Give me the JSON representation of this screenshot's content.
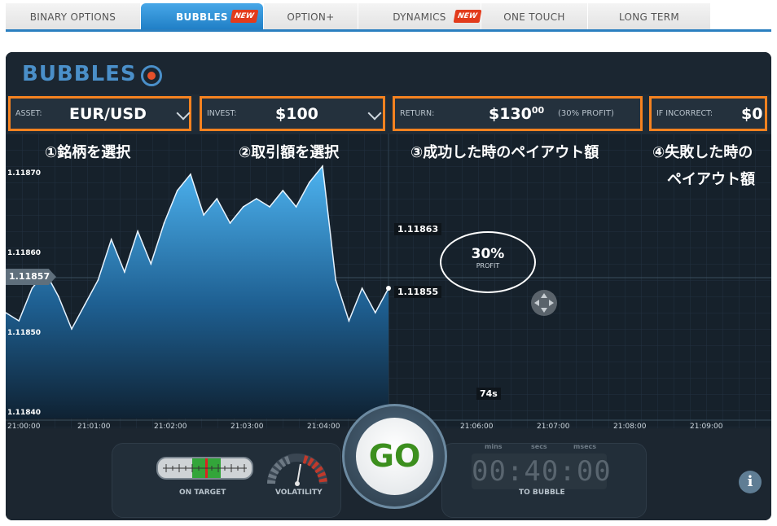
{
  "tabs": [
    {
      "label": "BINARY OPTIONS",
      "active": false,
      "badge": ""
    },
    {
      "label": "BUBBLES",
      "active": true,
      "badge": "NEW"
    },
    {
      "label": "OPTION+",
      "active": false,
      "badge": ""
    },
    {
      "label": "DYNAMICS",
      "active": false,
      "badge": "NEW"
    },
    {
      "label": "ONE TOUCH",
      "active": false,
      "badge": ""
    },
    {
      "label": "LONG TERM",
      "active": false,
      "badge": ""
    }
  ],
  "logo": {
    "text": "BUBBLES"
  },
  "controls": {
    "asset": {
      "label": "ASSET:",
      "value": "EUR/USD"
    },
    "invest": {
      "label": "INVEST:",
      "value": "$100"
    },
    "return": {
      "label": "RETURN:",
      "value": "$130",
      "cents": "00",
      "profit_note": "(30% PROFIT)"
    },
    "incorrect": {
      "label": "IF INCORRECT:",
      "value": "$0"
    }
  },
  "annotations": {
    "a1": "①銘柄を選択",
    "a2": "②取引額を選択",
    "a3": "③成功した時のペイアウト額",
    "a4_line1": "④失敗した時の",
    "a4_line2": "ペイアウト額"
  },
  "chart": {
    "y_labels": [
      "1.11870",
      "1.11860",
      "1.11850",
      "1.11840"
    ],
    "x_labels": [
      "21:00:00",
      "21:01:00",
      "21:02:00",
      "21:03:00",
      "21:04:00",
      "21:06:00",
      "21:07:00",
      "21:08:00",
      "21:09:00"
    ],
    "current_price": "1.11857",
    "upper_target": "1.11863",
    "lower_target": "1.11855",
    "profit_pct": "30%",
    "profit_label": "PROFIT",
    "timer": "74s"
  },
  "chart_data": {
    "type": "area",
    "title": "",
    "ylim": [
      1.1184,
      1.11872
    ],
    "xlabel": "",
    "ylabel": "",
    "x": [
      "21:00:00",
      "21:00:10",
      "21:00:20",
      "21:00:30",
      "21:00:40",
      "21:00:50",
      "21:01:00",
      "21:01:10",
      "21:01:20",
      "21:01:30",
      "21:01:40",
      "21:01:50",
      "21:02:00",
      "21:02:10",
      "21:02:20",
      "21:02:30",
      "21:02:40",
      "21:02:50",
      "21:03:00",
      "21:03:10",
      "21:03:20",
      "21:03:30",
      "21:03:40",
      "21:03:50",
      "21:04:00",
      "21:04:10",
      "21:04:20",
      "21:04:30",
      "21:04:40",
      "21:04:50"
    ],
    "series": [
      {
        "values": [
          1.11853,
          1.11852,
          1.11856,
          1.11858,
          1.11855,
          1.11851,
          1.11854,
          1.11857,
          1.11862,
          1.11858,
          1.11863,
          1.11859,
          1.11864,
          1.11868,
          1.1187,
          1.11865,
          1.11867,
          1.11864,
          1.11866,
          1.11867,
          1.11866,
          1.11868,
          1.11866,
          1.11869,
          1.11871,
          1.11857,
          1.11852,
          1.11856,
          1.11853,
          1.11856
        ]
      }
    ]
  },
  "bottom": {
    "on_target": "ON TARGET",
    "volatility": "VOLATILITY",
    "go": "GO",
    "units": [
      "mins",
      "secs",
      "msecs"
    ],
    "countdown": "00:40:00",
    "to_bubble": "TO BUBBLE",
    "info": "i"
  },
  "colors": {
    "accent": "#f58220",
    "brand": "#4a8fc9",
    "go": "#3c8f1e",
    "area_top": "#4db3f0",
    "area_bottom": "#0f2a44"
  }
}
